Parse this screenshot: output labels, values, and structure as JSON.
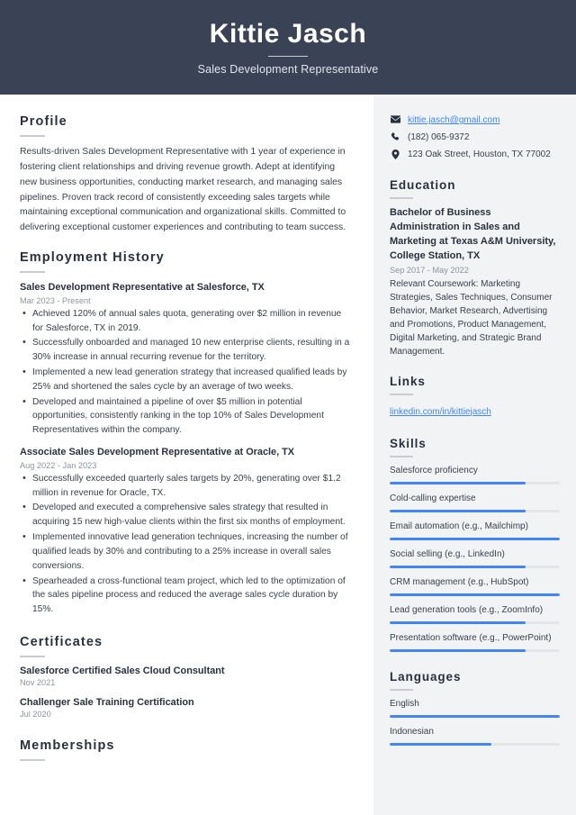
{
  "header": {
    "name": "Kittie Jasch",
    "job_title": "Sales Development Representative"
  },
  "theme": {
    "header_bg": "#3a4356",
    "sidebar_bg": "#f2f3f5",
    "accent_blue": "#4285f4",
    "heading_color": "#29313f",
    "muted_text": "#8d939e",
    "bar_track": "#e3e5e8"
  },
  "main": {
    "profile": {
      "title": "Profile",
      "text": "Results-driven Sales Development Representative with 1 year of experience in fostering client relationships and driving revenue growth. Adept at identifying new business opportunities, conducting market research, and managing sales pipelines. Proven track record of consistently exceeding sales targets while maintaining exceptional communication and organizational skills. Committed to delivering exceptional customer experiences and contributing to team success."
    },
    "employment": {
      "title": "Employment History",
      "jobs": [
        {
          "heading": "Sales Development Representative at Salesforce, TX",
          "date": "Mar 2023 - Present",
          "bullets": [
            "Achieved 120% of annual sales quota, generating over $2 million in revenue for Salesforce, TX in 2019.",
            "Successfully onboarded and managed 10 new enterprise clients, resulting in a 30% increase in annual recurring revenue for the territory.",
            "Implemented a new lead generation strategy that increased qualified leads by 25% and shortened the sales cycle by an average of two weeks.",
            "Developed and maintained a pipeline of over $5 million in potential opportunities, consistently ranking in the top 10% of Sales Development Representatives within the company."
          ]
        },
        {
          "heading": "Associate Sales Development Representative at Oracle, TX",
          "date": "Aug 2022 - Jan 2023",
          "bullets": [
            "Successfully exceeded quarterly sales targets by 20%, generating over $1.2 million in revenue for Oracle, TX.",
            "Developed and executed a comprehensive sales strategy that resulted in acquiring 15 new high-value clients within the first six months of employment.",
            "Implemented innovative lead generation techniques, increasing the number of qualified leads by 30% and contributing to a 25% increase in overall sales conversions.",
            "Spearheaded a cross-functional team project, which led to the optimization of the sales pipeline process and reduced the average sales cycle duration by 15%."
          ]
        }
      ]
    },
    "certificates": {
      "title": "Certificates",
      "items": [
        {
          "name": "Salesforce Certified Sales Cloud Consultant",
          "date": "Nov 2021"
        },
        {
          "name": "Challenger Sale Training Certification",
          "date": "Jul 2020"
        }
      ]
    },
    "memberships": {
      "title": "Memberships"
    }
  },
  "aside": {
    "contact": [
      {
        "icon": "envelope-icon",
        "text": "kittie.jasch@gmail.com",
        "is_link": true
      },
      {
        "icon": "phone-icon",
        "text": "(182) 065-9372",
        "is_link": false
      },
      {
        "icon": "location-pin-icon",
        "text": "123 Oak Street, Houston, TX 77002",
        "is_link": false
      }
    ],
    "education": {
      "title": "Education",
      "degree": "Bachelor of Business Administration in Sales and Marketing at Texas A&M University, College Station, TX",
      "date": "Sep 2017 - May 2022",
      "description": "Relevant Coursework: Marketing Strategies, Sales Techniques, Consumer Behavior, Market Research, Advertising and Promotions, Product Management, Digital Marketing, and Strategic Brand Management."
    },
    "links": {
      "title": "Links",
      "items": [
        "linkedin.com/in/kittiejasch"
      ]
    },
    "skills": {
      "title": "Skills",
      "items": [
        {
          "label": "Salesforce proficiency",
          "level": 80
        },
        {
          "label": "Cold-calling expertise",
          "level": 80
        },
        {
          "label": "Email automation (e.g., Mailchimp)",
          "level": 100
        },
        {
          "label": "Social selling (e.g., LinkedIn)",
          "level": 80
        },
        {
          "label": "CRM management (e.g., HubSpot)",
          "level": 100
        },
        {
          "label": "Lead generation tools (e.g., ZoomInfo)",
          "level": 80
        },
        {
          "label": "Presentation software (e.g., PowerPoint)",
          "level": 80
        }
      ]
    },
    "languages": {
      "title": "Languages",
      "items": [
        {
          "label": "English",
          "level": 100
        },
        {
          "label": "Indonesian",
          "level": 60
        }
      ]
    }
  }
}
